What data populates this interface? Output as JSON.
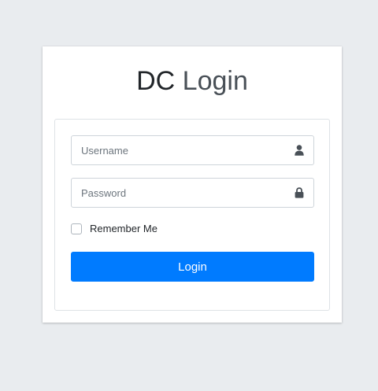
{
  "logo": {
    "brand": "DC",
    "title": "Login"
  },
  "form": {
    "username_placeholder": "Username",
    "username_value": "",
    "username_icon": "user-icon",
    "password_placeholder": "Password",
    "password_value": "",
    "password_icon": "lock-icon",
    "remember_label": "Remember Me",
    "remember_checked": false,
    "login_label": "Login"
  },
  "colors": {
    "accent": "#007bff",
    "background": "#e9ecef"
  }
}
